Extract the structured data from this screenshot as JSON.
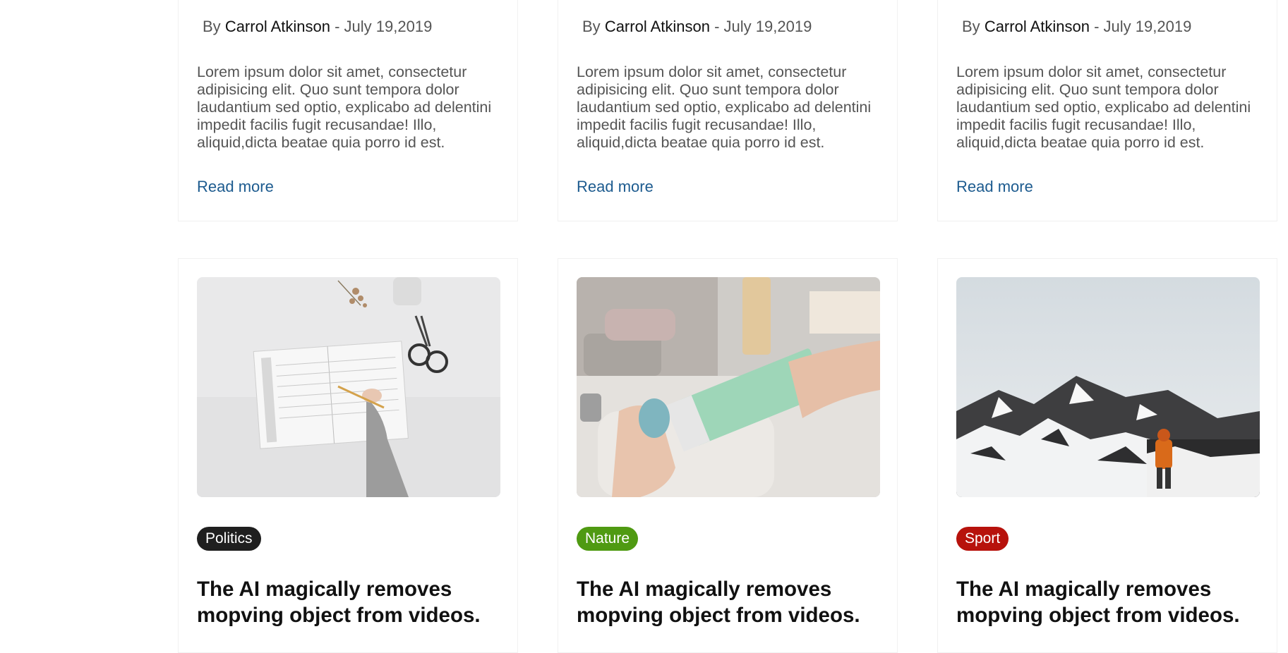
{
  "top_cards": [
    {
      "by": "By",
      "author": "Carrol Atkinson",
      "date": " - July 19,2019",
      "excerpt": "Lorem ipsum dolor sit amet, consectetur adipisicing elit. Quo sunt tempora dolor laudantium sed optio, explicabo ad delentini impedit facilis fugit recusandae! Illo, aliquid,dicta beatae quia porro id est.",
      "read_more": "Read more"
    },
    {
      "by": "By",
      "author": "Carrol Atkinson",
      "date": " - July 19,2019",
      "excerpt": "Lorem ipsum dolor sit amet, consectetur adipisicing elit. Quo sunt tempora dolor laudantium sed optio, explicabo ad delentini impedit facilis fugit recusandae! Illo, aliquid,dicta beatae quia porro id est.",
      "read_more": "Read more"
    },
    {
      "by": "By",
      "author": "Carrol Atkinson",
      "date": " - July 19,2019",
      "excerpt": "Lorem ipsum dolor sit amet, consectetur adipisicing elit. Quo sunt tempora dolor laudantium sed optio, explicabo ad delentini impedit facilis fugit recusandae! Illo, aliquid,dicta beatae quia porro id est.",
      "read_more": "Read more"
    }
  ],
  "bottom_cards": [
    {
      "category": "Politics",
      "category_color": "#1f1f1f",
      "title": "The AI magically removes mopving object from videos.",
      "image": "planner-writing-photo"
    },
    {
      "category": "Nature",
      "category_color": "#4f9a12",
      "title": "The AI magically removes mopving object from videos.",
      "image": "hands-holding-box-photo"
    },
    {
      "category": "Sport",
      "category_color": "#b7120c",
      "title": "The AI magically removes mopving object from videos.",
      "image": "snowy-mountain-hiker-photo"
    }
  ]
}
